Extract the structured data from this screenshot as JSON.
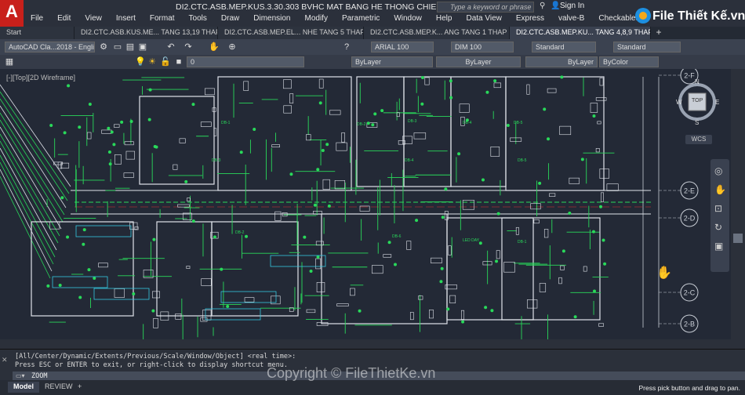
{
  "window": {
    "title": "DI2.CTC.ASB.MEP.KUS.3.30.303 BVHC MAT BANG HE THONG CHIEU SANG TANG 4,8,...",
    "search_placeholder": "Type a keyword or phrase",
    "signin_label": "Sign In",
    "app_letter": "A"
  },
  "menu": [
    "File",
    "Edit",
    "View",
    "Insert",
    "Format",
    "Tools",
    "Draw",
    "Dimension",
    "Modify",
    "Parametric",
    "Window",
    "Help",
    "Data View",
    "Express",
    "valve-B",
    "Checkables"
  ],
  "tabs": [
    {
      "label": "Start"
    },
    {
      "label": "DI2.CTC.ASB.KUS.ME... TANG 13,19 THAP 2*"
    },
    {
      "label": "DI2.CTC.ASB.MEP.EL... NHE TANG 5 THAP 2*"
    },
    {
      "label": "DI2.CTC.ASB.MEP.K... ANG TANG 1 THAP 2*"
    },
    {
      "label": "DI2.CTC.ASB.MEP.KU... TANG 4,8,9 THAP 2"
    }
  ],
  "toolbar": {
    "workspace": "AutoCAD Cla...2018 - English",
    "layer_value": "0",
    "text_style": "ARIAL 100",
    "dim_style": "DIM 100",
    "table_style": "Standard",
    "multileader_style": "Standard",
    "color": "ByLayer",
    "linetype": "ByLayer",
    "lineweight": "ByLayer",
    "plotstyle": "ByColor"
  },
  "viewport_label": "[-][Top][2D Wireframe]",
  "viewcube": {
    "top_label": "TOP",
    "wcs_label": "WCS",
    "north": "N",
    "south": "S",
    "east": "E",
    "west": "W"
  },
  "grid_bubbles": [
    "2-F",
    "2-E",
    "2-D",
    "2-C",
    "2-B"
  ],
  "room_labels": [
    "DB-1",
    "DB-2",
    "DB-3",
    "DB-4",
    "DB-5",
    "DB-6",
    "LED DAY"
  ],
  "command": {
    "history_1": "[All/Center/Dynamic/Extents/Previous/Scale/Window/Object] <real time>:",
    "history_2": "Press ESC or ENTER to exit, or right-click to display shortcut menu.",
    "current": "ZOOM"
  },
  "layout_tabs": [
    "Model",
    "REVIEW"
  ],
  "status_text": "Press pick button and drag to pan.",
  "watermark": "Copyright © FileThietKe.vn",
  "logo_text": "File Thiết Kế.vn",
  "colors": {
    "drawing_green": "#29d95a",
    "drawing_white": "#dfe3ea",
    "drawing_cyan": "#34c8e0",
    "drawing_red": "#e03030",
    "canvas_bg": "#232936"
  }
}
